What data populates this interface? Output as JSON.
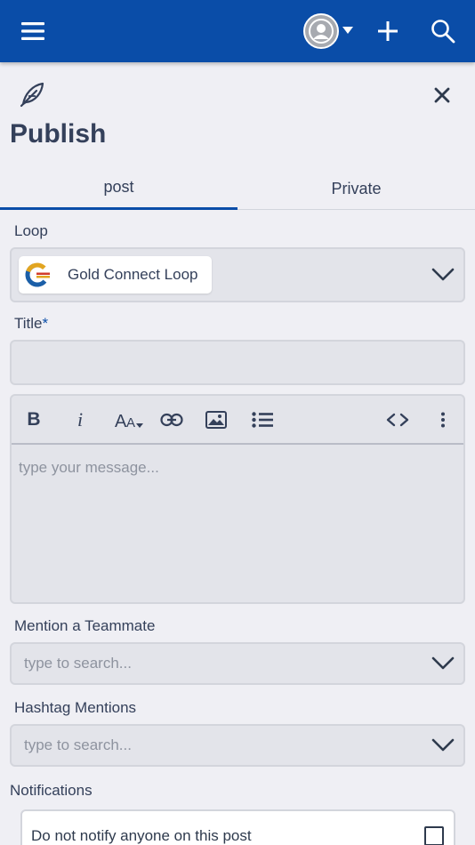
{
  "header": {
    "menu_icon": "hamburger-menu-icon",
    "avatar_icon": "user-avatar-icon",
    "caret_icon": "caret-down-icon",
    "add_icon": "plus-icon",
    "search_icon": "search-icon",
    "bar_color": "#0a4da8"
  },
  "page": {
    "feather_icon": "feather-icon",
    "close_icon": "close-icon",
    "title": "Publish"
  },
  "tabs": [
    {
      "label": "post",
      "active": true
    },
    {
      "label": "Private",
      "active": false
    }
  ],
  "form": {
    "loop_label": "Loop",
    "loop_value": "Gold Connect Loop",
    "title_label": "Title",
    "title_required": "*",
    "title_value": "",
    "editor": {
      "tools": [
        "bold-icon",
        "italic-icon",
        "font-size-icon",
        "link-icon",
        "image-icon",
        "bullet-list-icon",
        "code-icon",
        "more-vertical-icon"
      ],
      "bold_glyph": "B",
      "italic_glyph": "i",
      "placeholder": "type your message..."
    },
    "mention_label": "Mention a Teammate",
    "mention_placeholder": "type to search...",
    "hashtag_label": "Hashtag Mentions",
    "hashtag_placeholder": "type to search...",
    "notifications_label": "Notifications",
    "notify_option": "Do not notify anyone on this post",
    "notify_checked": false
  }
}
